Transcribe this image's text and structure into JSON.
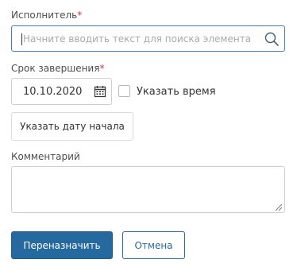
{
  "executor": {
    "label": "Исполнитель",
    "required_mark": "*",
    "placeholder": "Начните вводить текст для поиска элемента",
    "value": "",
    "search_icon": "search-icon"
  },
  "due_date": {
    "label": "Срок завершения",
    "required_mark": "*",
    "value": "10.10.2020",
    "calendar_icon": "calendar-icon"
  },
  "specify_time": {
    "label": "Указать время",
    "checked": false
  },
  "start_date_button": {
    "label": "Указать дату начала"
  },
  "comment": {
    "label": "Комментарий",
    "value": ""
  },
  "actions": {
    "reassign_label": "Переназначить",
    "cancel_label": "Отмена"
  },
  "colors": {
    "accent": "#26699f",
    "focus_border": "#3f7fc8",
    "required": "#d0342c"
  }
}
